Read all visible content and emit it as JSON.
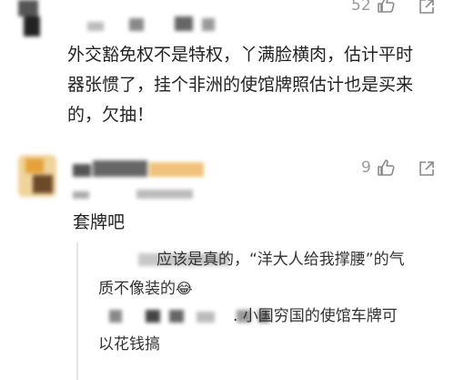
{
  "comment1": {
    "like_count": "52",
    "text_lines": [
      "外交豁免权不是特权，丫满脸横肉，估计平时",
      "器张惯了，挂个非洲的使馆牌照估计也是买来",
      "的，欠抽！"
    ]
  },
  "comment2": {
    "like_count": "9",
    "text": "套牌吧",
    "replies": [
      {
        "text_lines": [
          "应该是真的，“洋大人给我撑腰”的气",
          "质不像装的"
        ],
        "emoji": "😂"
      },
      {
        "text_lines": [
          ". 小国穷国的使馆车牌可",
          "以花钱搞"
        ]
      }
    ]
  },
  "icons": {
    "like": "thumbs-up-icon",
    "share": "share-icon"
  },
  "colors": {
    "text": "#222222",
    "muted": "#9a9a9a",
    "reply_border": "#e6e6e6"
  }
}
